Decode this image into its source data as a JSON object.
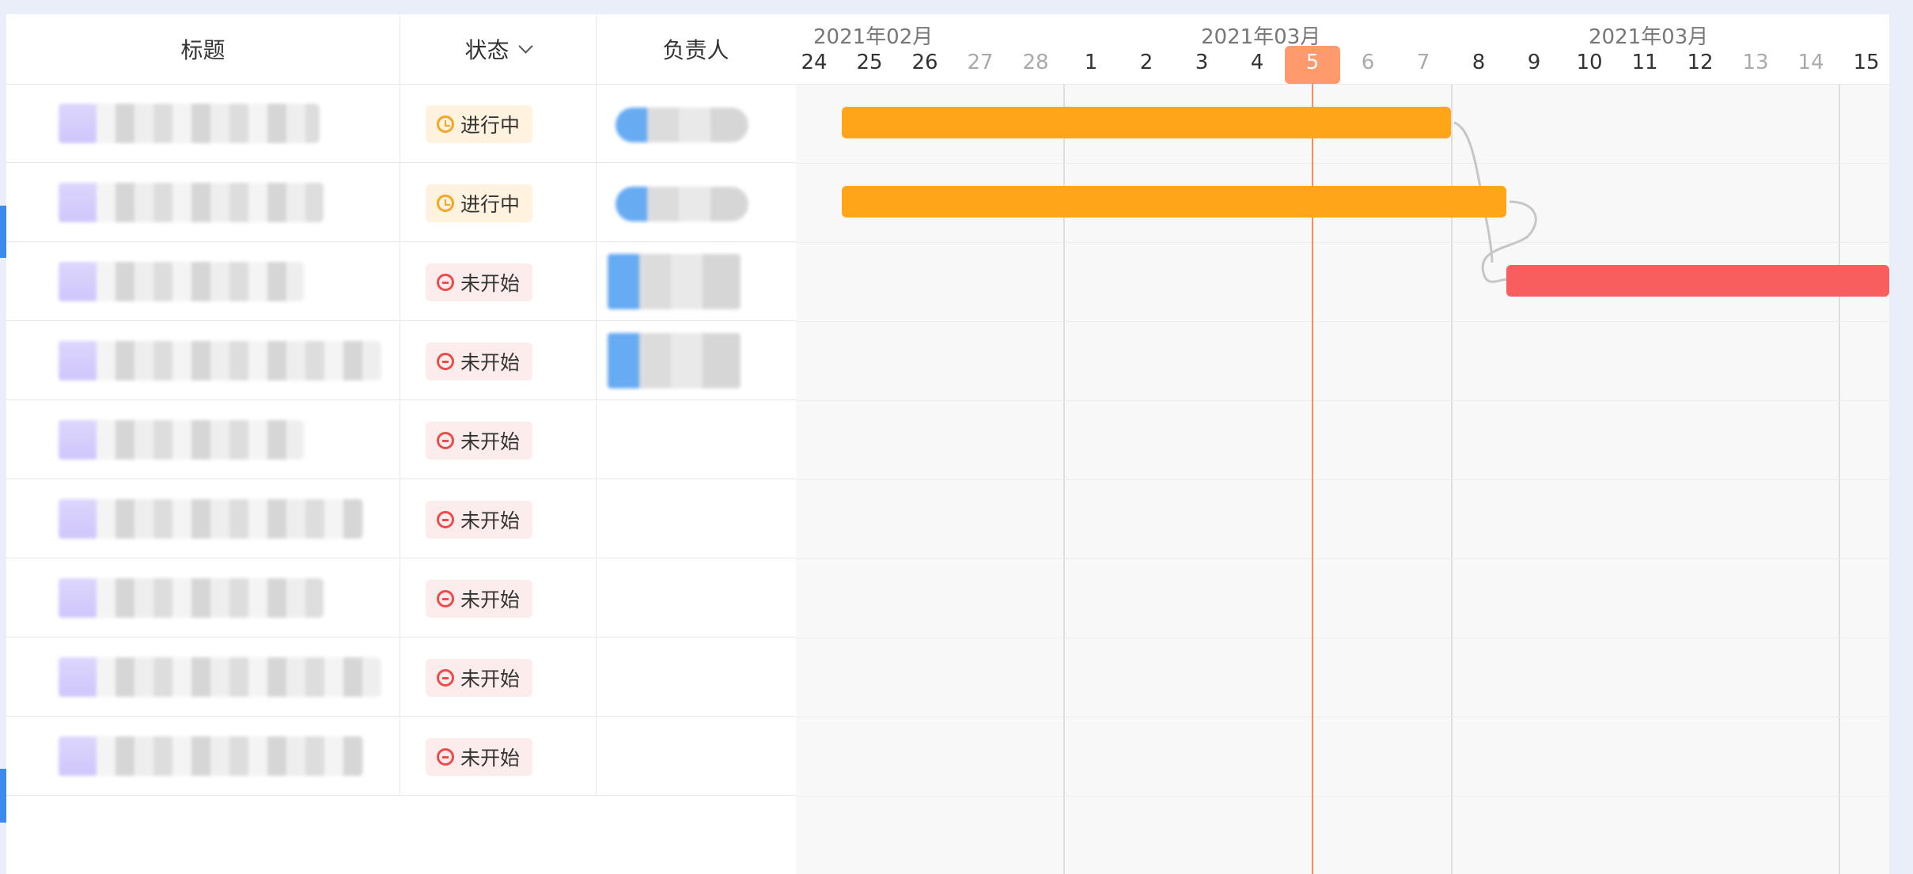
{
  "table": {
    "headers": {
      "title": "标题",
      "status": "状态",
      "owner": "负责人"
    },
    "rows": [
      {
        "status": "进行中",
        "status_kind": "in-progress",
        "has_owner": true
      },
      {
        "status": "进行中",
        "status_kind": "in-progress",
        "has_owner": true
      },
      {
        "status": "未开始",
        "status_kind": "not-started",
        "has_owner": true
      },
      {
        "status": "未开始",
        "status_kind": "not-started",
        "has_owner": true
      },
      {
        "status": "未开始",
        "status_kind": "not-started",
        "has_owner": false
      },
      {
        "status": "未开始",
        "status_kind": "not-started",
        "has_owner": false
      },
      {
        "status": "未开始",
        "status_kind": "not-started",
        "has_owner": false
      },
      {
        "status": "未开始",
        "status_kind": "not-started",
        "has_owner": false
      },
      {
        "status": "未开始",
        "status_kind": "not-started",
        "has_owner": false
      }
    ]
  },
  "gantt": {
    "months": [
      "2021年02月",
      "2021年03月",
      "2021年03月"
    ],
    "days": [
      "24",
      "25",
      "26",
      "27",
      "28",
      "1",
      "2",
      "3",
      "4",
      "5",
      "6",
      "7",
      "8",
      "9",
      "10",
      "11",
      "12",
      "13",
      "14",
      "15"
    ],
    "weekend_days": [
      "27",
      "28",
      "6",
      "7",
      "13",
      "14"
    ],
    "today": "5",
    "tasks": [
      {
        "row": 0,
        "start_day": "25",
        "end_day": "7",
        "color": "#ffa518"
      },
      {
        "row": 1,
        "start_day": "25",
        "end_day": "8",
        "color": "#ffa518"
      },
      {
        "row": 2,
        "start_day": "9",
        "end_day": "15",
        "color": "#f75e5e"
      }
    ]
  },
  "colors": {
    "in_progress": "#f5a623",
    "not_started": "#ee4b4b",
    "today": "#ff8a5c",
    "accent": "#3b8bec"
  }
}
